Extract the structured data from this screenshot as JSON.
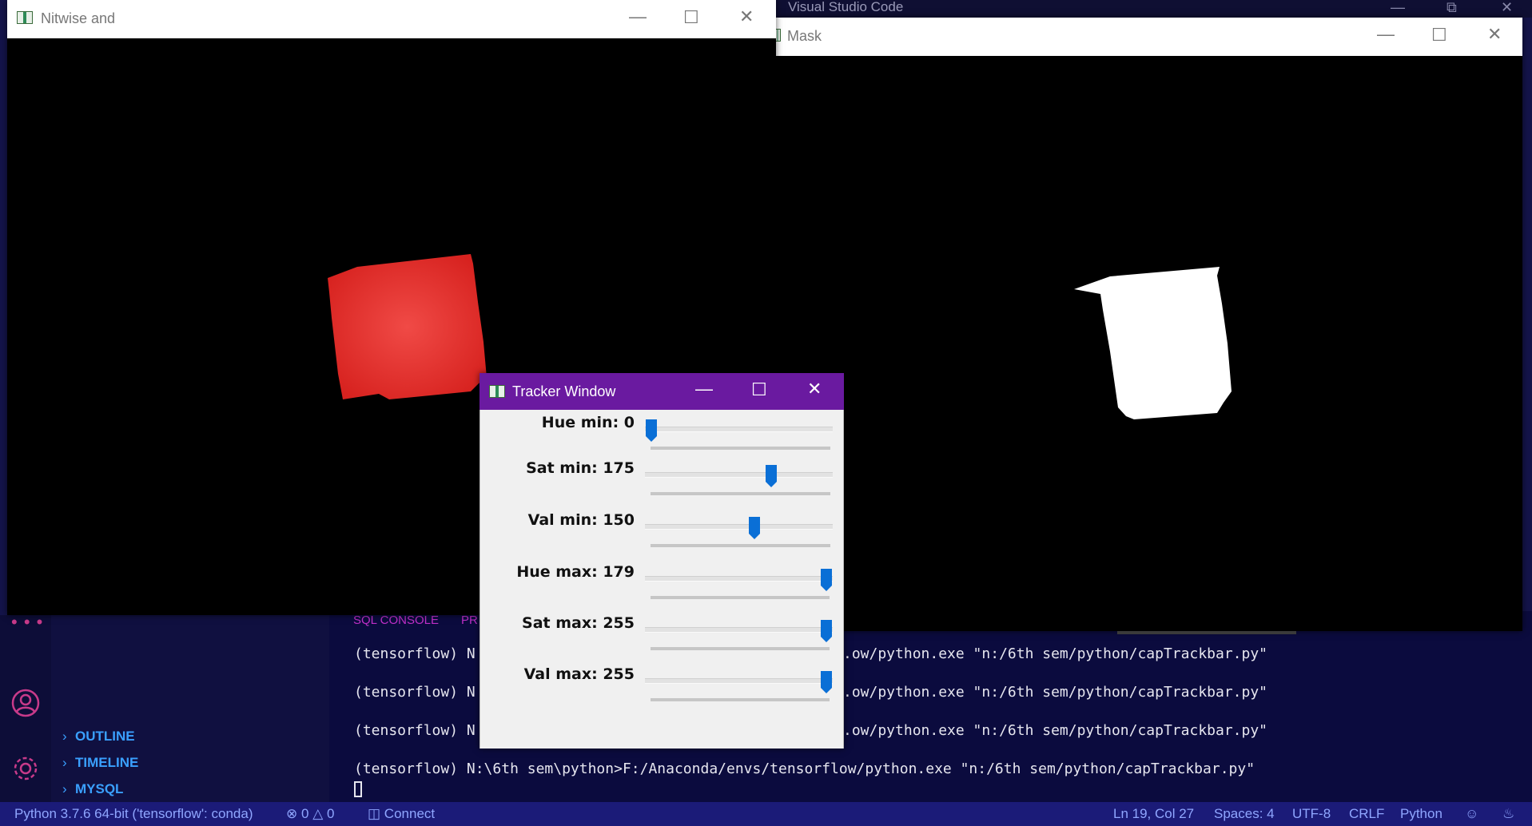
{
  "vscode": {
    "title": "Visual Studio Code",
    "sidebar": {
      "items": [
        {
          "label": "OUTLINE"
        },
        {
          "label": "TIMELINE"
        },
        {
          "label": "MYSQL"
        }
      ]
    },
    "panel": {
      "tabs": [
        "SQL CONSOLE",
        "PR"
      ],
      "terminal_lines": [
        {
          "prefix": "(tensorflow) N",
          "tail": ".ow/python.exe \"n:/6th sem/python/capTrackbar.py\""
        },
        {
          "prefix": "(tensorflow) N",
          "tail": ".ow/python.exe \"n:/6th sem/python/capTrackbar.py\""
        },
        {
          "prefix": "(tensorflow) N",
          "tail": ".ow/python.exe \"n:/6th sem/python/capTrackbar.py\""
        }
      ],
      "full_line": "(tensorflow) N:\\6th sem\\python>F:/Anaconda/envs/tensorflow/python.exe \"n:/6th sem/python/capTrackbar.py\""
    },
    "statusbar": {
      "interpreter": "Python 3.7.6 64-bit ('tensorflow': conda)",
      "errors": "0",
      "warnings": "0",
      "connect": "Connect",
      "position": "Ln 19, Col 27",
      "spaces": "Spaces: 4",
      "encoding": "UTF-8",
      "eol": "CRLF",
      "language": "Python"
    }
  },
  "windows": {
    "nitwise": {
      "title": "Nitwise and"
    },
    "mask": {
      "title": "Mask"
    },
    "tracker": {
      "title": "Tracker Window"
    }
  },
  "trackbars": [
    {
      "label": "Hue min: 0",
      "value": 0,
      "max": 179
    },
    {
      "label": "Sat min: 175",
      "value": 175,
      "max": 255
    },
    {
      "label": "Val min: 150",
      "value": 150,
      "max": 255
    },
    {
      "label": "Hue max: 179",
      "value": 179,
      "max": 179
    },
    {
      "label": "Sat max: 255",
      "value": 255,
      "max": 255
    },
    {
      "label": "Val max: 255",
      "value": 255,
      "max": 255
    }
  ],
  "colors": {
    "tracker_titlebar": "#6a1aa0",
    "object_red": "#e8302c",
    "thumb_blue": "#0a6fd6",
    "statusbar": "#1b1b78"
  },
  "icons": [
    "window-app-icon",
    "minimize-icon",
    "maximize-icon",
    "close-icon",
    "account-icon",
    "gear-icon",
    "chevron-right-icon",
    "error-icon",
    "warning-icon",
    "database-icon",
    "feedback-icon",
    "bell-icon"
  ]
}
